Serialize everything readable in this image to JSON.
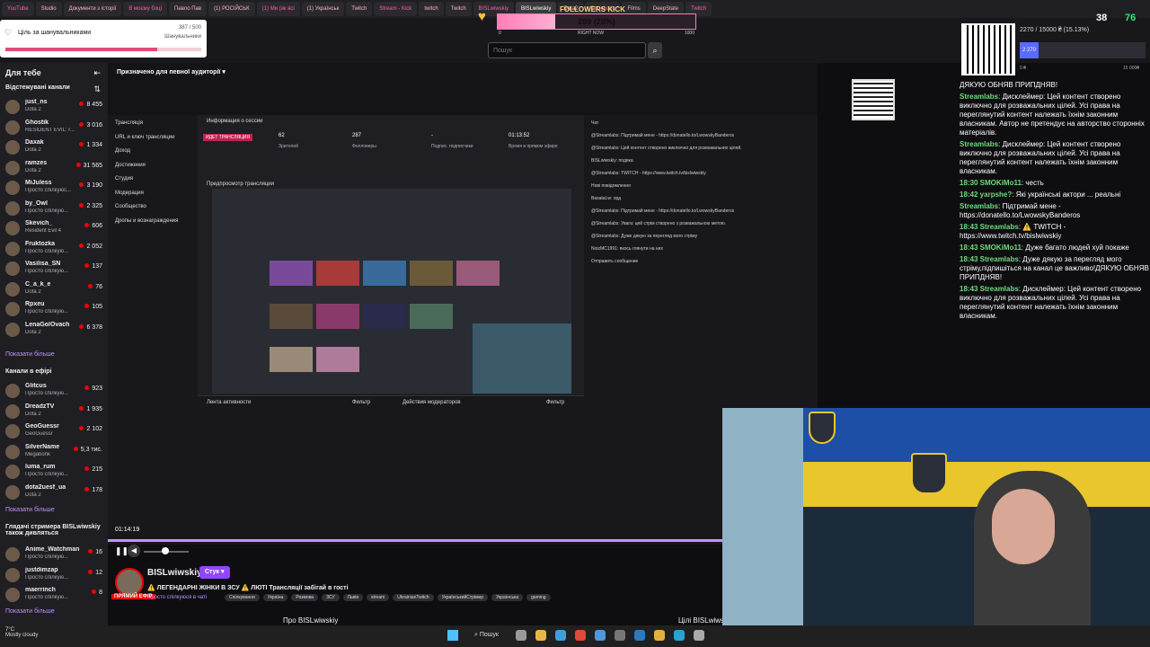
{
  "browser": {
    "tabs": [
      "YouTube",
      "Studio",
      "Документи з історії",
      "В моєму боці",
      "Павло Пав",
      "(1) РОСІЙСЬК",
      "(1) Ми (як всі",
      "(1) Українськ",
      "Twitch",
      "Stream - Kick",
      "twitch",
      "Twitch",
      "BISLwiwskiy",
      "BISLwiwskiy",
      "Dota2",
      "Donations",
      "Films",
      "DeepState",
      "Twitch"
    ],
    "active_tab": 13
  },
  "follow_goal": {
    "label": "FOLLOWERS KICK",
    "text": "289 (28%)",
    "progress": 0.289,
    "min": "0",
    "mid": "RIGHT NOW",
    "max": "1000"
  },
  "sub_goal": {
    "title": "Ціль за шанувальниками",
    "count": "387 / 500",
    "sub": "Шанувальники",
    "progress": 0.774
  },
  "right_goal": {
    "text": "2270 / 15000 ₴ (15.13%)",
    "bar_label": "2 270",
    "progress": 0.1513,
    "min": "0 ₴",
    "max": "15 000₴",
    "stat1": "38",
    "stat2": "76"
  },
  "search": {
    "placeholder": "Пошук"
  },
  "sidebar": {
    "header": "Для тебе",
    "followed_title": "Відстежувані канали",
    "followed": [
      {
        "name": "just_ns",
        "game": "Dota 2",
        "viewers": "8 455"
      },
      {
        "name": "Ghostik",
        "game": "RESIDENT EVIL: r...",
        "viewers": "3 016"
      },
      {
        "name": "Daxak",
        "game": "Dota 2",
        "viewers": "1 334"
      },
      {
        "name": "ramzes",
        "game": "Dota 2",
        "viewers": "31 565"
      },
      {
        "name": "MiJuless",
        "game": "Просто спілкуюс...",
        "viewers": "3 190"
      },
      {
        "name": "by_Owl",
        "game": "Просто спілкую...",
        "viewers": "2 325"
      },
      {
        "name": "Skevich_",
        "game": "Resident Evil 4",
        "viewers": "606"
      },
      {
        "name": "Fruktozka",
        "game": "Просто спілкую...",
        "viewers": "2 052"
      },
      {
        "name": "Vasilisa_SN",
        "game": "Просто спілкую...",
        "viewers": "137"
      },
      {
        "name": "C_a_k_e",
        "game": "Dota 2",
        "viewers": "76"
      },
      {
        "name": "Rpxeu",
        "game": "Просто спілкую...",
        "viewers": "105"
      },
      {
        "name": "LenaGolOvach",
        "game": "Dota 2",
        "viewers": "6 378"
      }
    ],
    "show_more_1": "Показати більше",
    "live_title": "Канали в ефірі",
    "live": [
      {
        "name": "Glitcus",
        "game": "Просто спілкую...",
        "viewers": "923"
      },
      {
        "name": "DreadzTV",
        "game": "Dota 2",
        "viewers": "1 935"
      },
      {
        "name": "GeoGuessr",
        "game": "GeoGuessr",
        "viewers": "2 102"
      },
      {
        "name": "SilverName",
        "game": "Megabonk",
        "viewers": "5,3 тис."
      },
      {
        "name": "luma_rum",
        "game": "Просто спілкую...",
        "viewers": "215"
      },
      {
        "name": "dota2uesf_ua",
        "game": "Dota 2",
        "viewers": "178"
      }
    ],
    "show_more_2": "Показати більше",
    "also_title": "Глядачі стримера BISLwiwskiy також дивляться",
    "also": [
      {
        "name": "Anime_Watchman",
        "game": "Просто спілкую...",
        "viewers": "16"
      },
      {
        "name": "justdimzap",
        "game": "Просто спілкую...",
        "viewers": "12"
      },
      {
        "name": "maerrinch",
        "game": "Просто спілкую...",
        "viewers": "8"
      }
    ],
    "show_more_3": "Показати більше"
  },
  "dashboard": {
    "audience": "Призначено для певної аудиторії",
    "nav": [
      "Трансляція",
      "URL и ключ трансляции",
      "Доход",
      "Достижения",
      "Студия",
      "Модерация",
      "Сообщество",
      "Дропы и вознаграждения"
    ],
    "session_title": "Информация о сессии",
    "live_badge": "ИДЕТ ТРАНСЛЯЦИЯ",
    "stats": [
      {
        "value": "62",
        "label": "Зрителей"
      },
      {
        "value": "287",
        "label": "Фолловеры"
      },
      {
        "value": "-",
        "label": "Подпис. подписчики"
      },
      {
        "value": "01:13:52",
        "label": "Время в прямом эфире"
      }
    ],
    "preview_title": "Предпросмотр трансляции",
    "activity_title": "Лента активности",
    "mod_title": "Действия модераторов",
    "filter": "Фильтр",
    "chat_title": "Чат",
    "chat_lines": [
      "@Streamlabs: Підтримай мене - https://donatello.to/LwowskyBanderos",
      "@Streamlabs: Цей контент створено виключно для розважальних цілей.",
      "BISLwiwskiy: подяка",
      "@Streamlabs: TWITCH - https://www.twitch.tv/bislwiwskiy",
      "Нові повідомлення",
      "BasataLw: орд",
      "@Streamlabs: Підтримай мене - https://donatello.to/LwowskyBanderos",
      "@Streamlabs: Увага: цей стрім створено з розважальною метою.",
      "@Streamlabs: Дуже дякую за перегляд мого стріму",
      "NoizMC1991: якось глянути на них",
      "Отправить сообщение"
    ]
  },
  "player": {
    "time": "01:14:19",
    "seek_progress": 1.0,
    "volume": 0.4
  },
  "channel": {
    "name": "BISLwiwskiy",
    "follow_label": "Стук",
    "live_tag": "ПРЯМИЙ ЕФІР",
    "title": "⚠️ ЛЕГЕНДАРНІ ЖІНКИ В ЗСУ ⚠️ ЛЮТІ Трансляції забігай в гості",
    "category": "Просто спілкуюся в чаті",
    "tags": [
      "Спілкування",
      "Україна",
      "Розмова",
      "ЗСУ",
      "Львів",
      "stream",
      "UkrainianTwitch",
      "УкраїнськийСтрімер",
      "Українська",
      "gaming"
    ],
    "about_left": "Про BISLwiwskiy",
    "about_right": "Цілі BISLwiwskiy"
  },
  "overlay_chat": [
    {
      "name": "",
      "text": "ДЯКУЮ ОБНЯВ ПРИПДНЯВ!"
    },
    {
      "name": "Streamlabs",
      "text": ": Дисклеймер: Цей контент створено виключно для розважальних цілей. Усі права на переглянутий контент належать їхнім законним власникам. Автор не претендує на авторство сторонніх матеріалів."
    },
    {
      "name": "Streamlabs",
      "text": ": Дисклеймер: Цей контент створено виключно для розважальних цілей. Усі права на переглянутий контент належать їхнім законним власникам."
    },
    {
      "name": "18:30 SMOKiMo11",
      "text": ": честь"
    },
    {
      "name": "18:42 yarpshe?",
      "text": ": Які українські актори ... реальні"
    },
    {
      "name": "Streamlabs",
      "text": ": Підтримай мене - https://donatello.to/LwowskyBanderos"
    },
    {
      "name": "18:43 Streamlabs",
      "text": ": ⚠️ TWITCH - https://www.twitch.tv/bislwiwskiy"
    },
    {
      "name": "18:43 SMOKiMo11",
      "text": ": Дуже багато людей хуй покаже"
    },
    {
      "name": "18:43 Streamlabs",
      "text": ": Дуже дякую за перегляд мого стріму,підпишіться на канал це важливо!ДЯКУЮ ОБНЯВ ПРИПДНЯВ!"
    },
    {
      "name": "18:43 Streamlabs",
      "text": ": Дисклеймер: Цей контент створено виключно для розважальних цілей. Усі права на переглянутий контент належать їхнім законним власникам."
    }
  ],
  "taskbar": {
    "temp": "7°C",
    "weather": "Mostly cloudy",
    "search": "Пошук"
  },
  "colors": {
    "twitch_purple": "#9147ff",
    "live_red": "#eb0400",
    "goal_pink": "#ff7eb6"
  }
}
